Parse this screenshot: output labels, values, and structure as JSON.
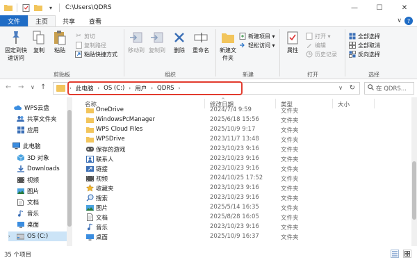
{
  "window": {
    "path_title": "C:\\Users\\QDRS",
    "minimize": "—",
    "maximize": "☐",
    "close": "✕"
  },
  "tabs": {
    "file": "文件",
    "home": "主页",
    "share": "共享",
    "view": "查看",
    "expand": "∨",
    "help": "?"
  },
  "ribbon": {
    "clipboard": {
      "label": "剪贴板",
      "pin": "固定到快速访问",
      "copy": "复制",
      "paste": "粘贴",
      "cut": "剪切",
      "copy_path": "复制路径",
      "paste_shortcut": "粘贴快捷方式"
    },
    "organize": {
      "label": "组织",
      "move_to": "移动到",
      "copy_to": "复制到",
      "delete": "删除",
      "rename": "重命名"
    },
    "new": {
      "label": "新建",
      "new_folder": "新建文件夹",
      "new_item": "新建项目 ▾",
      "easy_access": "轻松访问 ▾"
    },
    "open": {
      "label": "打开",
      "properties": "属性",
      "open": "打开 ▾",
      "edit": "编辑",
      "history": "历史记录"
    },
    "select": {
      "label": "选择",
      "select_all": "全部选择",
      "select_none": "全部取消",
      "invert": "反向选择"
    }
  },
  "address": {
    "back": "←",
    "forward": "→",
    "recent": "∨",
    "up": "↑",
    "crumbs": [
      "此电脑",
      "OS (C:)",
      "用户",
      "QDRS"
    ],
    "sep": "›",
    "dropdown": "∨",
    "refresh": "↻",
    "search_placeholder": "在 QDRS..."
  },
  "nav": {
    "items": [
      {
        "label": "WPS云盘"
      },
      {
        "label": "共享文件夹"
      },
      {
        "label": "应用"
      },
      {
        "label": "此电脑"
      },
      {
        "label": "3D 对象"
      },
      {
        "label": "Downloads"
      },
      {
        "label": "视频"
      },
      {
        "label": "图片"
      },
      {
        "label": "文档"
      },
      {
        "label": "音乐"
      },
      {
        "label": "桌面"
      },
      {
        "label": "OS (C:)"
      }
    ]
  },
  "files": {
    "headers": {
      "name": "名称",
      "date": "修改日期",
      "type": "类型",
      "size": "大小",
      "sort_arrow": "^"
    },
    "rows": [
      {
        "name": "OneDrive",
        "date": "2024/7/4 9:59",
        "type": "文件夹"
      },
      {
        "name": "WindowsPcManager",
        "date": "2025/6/18 15:56",
        "type": "文件夹"
      },
      {
        "name": "WPS Cloud Files",
        "date": "2025/10/9 9:17",
        "type": "文件夹"
      },
      {
        "name": "WPSDrive",
        "date": "2023/11/7 13:48",
        "type": "文件夹"
      },
      {
        "name": "保存的游戏",
        "date": "2023/10/23 9:16",
        "type": "文件夹"
      },
      {
        "name": "联系人",
        "date": "2023/10/23 9:16",
        "type": "文件夹"
      },
      {
        "name": "链接",
        "date": "2023/10/23 9:16",
        "type": "文件夹"
      },
      {
        "name": "视频",
        "date": "2024/10/25 17:52",
        "type": "文件夹"
      },
      {
        "name": "收藏夹",
        "date": "2023/10/23 9:16",
        "type": "文件夹"
      },
      {
        "name": "搜索",
        "date": "2023/10/23 9:16",
        "type": "文件夹"
      },
      {
        "name": "图片",
        "date": "2025/5/14 16:35",
        "type": "文件夹"
      },
      {
        "name": "文档",
        "date": "2025/8/28 16:05",
        "type": "文件夹"
      },
      {
        "name": "音乐",
        "date": "2023/10/23 9:16",
        "type": "文件夹"
      },
      {
        "name": "桌面",
        "date": "2025/10/9 16:37",
        "type": "文件夹"
      }
    ]
  },
  "status": {
    "count": "35 个项目"
  }
}
